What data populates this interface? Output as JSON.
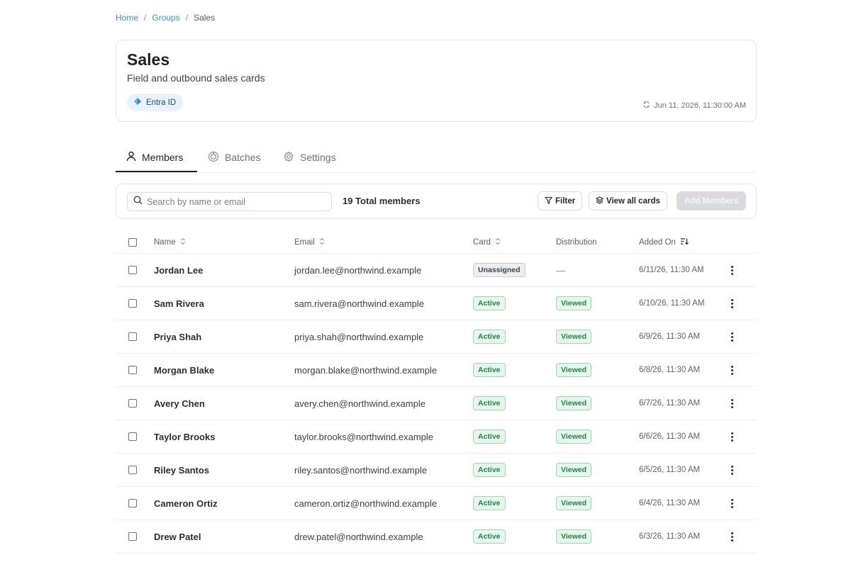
{
  "breadcrumb": {
    "home": "Home",
    "sep1": "/",
    "groups": "Groups",
    "sep2": "/",
    "current": "Sales"
  },
  "header": {
    "title": "Sales",
    "subtitle": "Field and outbound sales cards",
    "source_label": "Entra ID",
    "sync_time": "Jun 11, 2026, 11:30:00 AM"
  },
  "tabs": {
    "members": "Members",
    "batches": "Batches",
    "settings": "Settings",
    "active": "Members"
  },
  "toolbar": {
    "search_placeholder": "Search by name or email",
    "total_members": "19 Total members",
    "filter_label": "Filter",
    "view_cards_label": "View all cards",
    "add_members_label": "Add Members"
  },
  "table": {
    "headers": {
      "name": "Name",
      "email": "Email",
      "card": "Card",
      "distribution": "Distribution",
      "added_on": "Added On"
    },
    "rows": [
      {
        "name": "Jordan Lee",
        "email": "jordan.lee@northwind.example",
        "card": "Unassigned",
        "distribution": "—",
        "added_on": "6/11/26, 11:30 AM"
      },
      {
        "name": "Sam Rivera",
        "email": "sam.rivera@northwind.example",
        "card": "Active",
        "distribution": "Viewed",
        "added_on": "6/10/26, 11:30 AM"
      },
      {
        "name": "Priya Shah",
        "email": "priya.shah@northwind.example",
        "card": "Active",
        "distribution": "Viewed",
        "added_on": "6/9/26, 11:30 AM"
      },
      {
        "name": "Morgan Blake",
        "email": "morgan.blake@northwind.example",
        "card": "Active",
        "distribution": "Viewed",
        "added_on": "6/8/26, 11:30 AM"
      },
      {
        "name": "Avery Chen",
        "email": "avery.chen@northwind.example",
        "card": "Active",
        "distribution": "Viewed",
        "added_on": "6/7/26, 11:30 AM"
      },
      {
        "name": "Taylor Brooks",
        "email": "taylor.brooks@northwind.example",
        "card": "Active",
        "distribution": "Viewed",
        "added_on": "6/6/26, 11:30 AM"
      },
      {
        "name": "Riley Santos",
        "email": "riley.santos@northwind.example",
        "card": "Active",
        "distribution": "Viewed",
        "added_on": "6/5/26, 11:30 AM"
      },
      {
        "name": "Cameron Ortiz",
        "email": "cameron.ortiz@northwind.example",
        "card": "Active",
        "distribution": "Viewed",
        "added_on": "6/4/26, 11:30 AM"
      },
      {
        "name": "Drew Patel",
        "email": "drew.patel@northwind.example",
        "card": "Active",
        "distribution": "Viewed",
        "added_on": "6/3/26, 11:30 AM"
      }
    ]
  },
  "colors": {
    "accent_link": "#3b8fd6",
    "active_green": "#22834a",
    "badge_green_bg": "#e7f6ec",
    "disabled_button": "#d9dbde"
  }
}
